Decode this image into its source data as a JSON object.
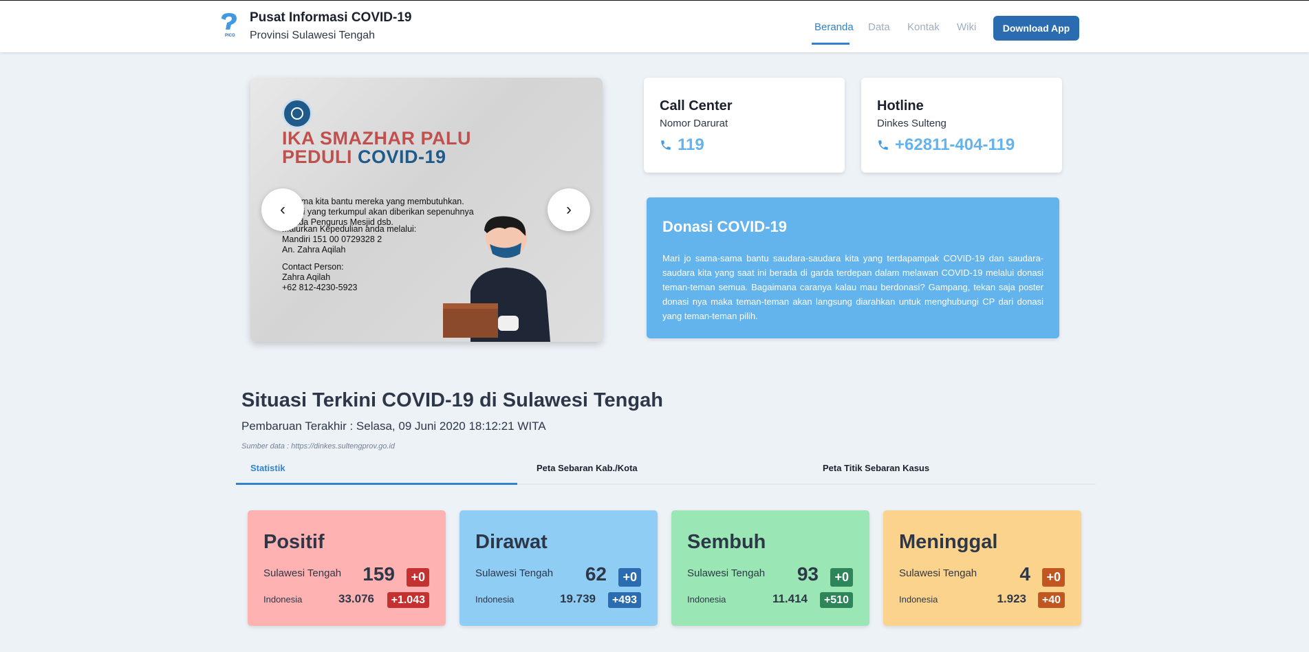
{
  "header": {
    "title": "Pusat Informasi COVID-19",
    "subtitle": "Provinsi Sulawesi Tengah",
    "logo_text": "PICO",
    "nav": [
      "Beranda",
      "Data",
      "Kontak",
      "Wiki"
    ],
    "download_label": "Download App"
  },
  "carousel": {
    "line1": "IKA SMAZHAR PALU",
    "line2a": "PEDULI ",
    "line2b": "COVID-19",
    "text": [
      "...rsama kita bantu mereka yang membutuhkan.",
      "...nasi yang terkumpul akan diberikan sepenuhnya",
      "...pada Pengurus Mesjid dsb.",
      "...alurkan Kepedulian anda melalui:",
      "Mandiri 151 00 0729328 2",
      "An. Zahra Aqilah",
      "Contact Person:",
      "Zahra Aqilah",
      "+62 812-4230-5923"
    ]
  },
  "contacts": [
    {
      "title": "Call Center",
      "sub": "Nomor Darurat",
      "phone": "119"
    },
    {
      "title": "Hotline",
      "sub": "Dinkes Sulteng",
      "phone": "+62811-404-119"
    }
  ],
  "donasi": {
    "title": "Donasi COVID-19",
    "body": "Mari jo sama-sama bantu saudara-saudara kita yang terdapampak COVID-19 dan saudara-saudara kita yang saat ini berada di garda terdepan dalam melawan COVID-19 melalui donasi teman-teman semua. Bagaimana caranya kalau mau berdonasi? Gampang, tekan saja poster donasi nya maka teman-teman akan langsung diarahkan untuk menghubungi CP dari donasi yang teman-teman pilih."
  },
  "situasi": {
    "title": "Situasi Terkini COVID-19 di Sulawesi Tengah",
    "update": "Pembaruan Terakhir : Selasa, 09 Juni 2020 18:12:21 WITA",
    "source": "Sumber data : https://dinkes.sultengprov.go.id"
  },
  "tabs": [
    "Statistik",
    "Peta Sebaran Kab./Kota",
    "Peta Titik Sebaran Kasus"
  ],
  "stats": [
    {
      "title": "Positif",
      "label1": "Sulawesi Tengah",
      "val1": "159",
      "delta1": "+0",
      "label2": "Indonesia",
      "val2": "33.076",
      "delta2": "+1.043",
      "bg": "#feb2b2",
      "badge": "#c53030"
    },
    {
      "title": "Dirawat",
      "label1": "Sulawesi Tengah",
      "val1": "62",
      "delta1": "+0",
      "label2": "Indonesia",
      "val2": "19.739",
      "delta2": "+493",
      "bg": "#90cdf4",
      "badge": "#2b6cb0"
    },
    {
      "title": "Sembuh",
      "label1": "Sulawesi Tengah",
      "val1": "93",
      "delta1": "+0",
      "label2": "Indonesia",
      "val2": "11.414",
      "delta2": "+510",
      "bg": "#9ae6b4",
      "badge": "#2f855a"
    },
    {
      "title": "Meninggal",
      "label1": "Sulawesi Tengah",
      "val1": "4",
      "delta1": "+0",
      "label2": "Indonesia",
      "val2": "1.923",
      "delta2": "+40",
      "bg": "#fbd38d",
      "badge": "#c05621"
    }
  ]
}
